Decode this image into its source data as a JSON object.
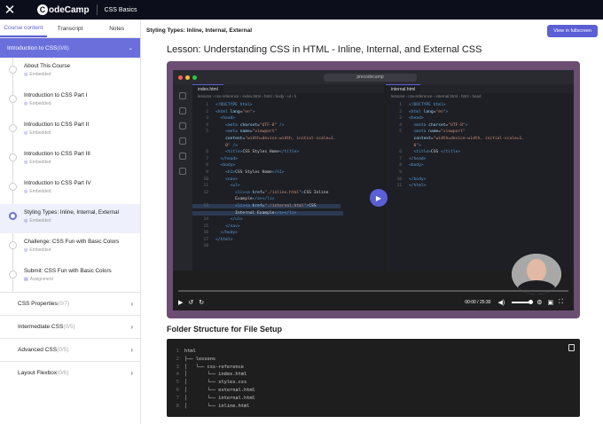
{
  "header": {
    "logo_text": "odeCamp",
    "logo_mark": "C",
    "course_title": "CSS Basics"
  },
  "sidebar": {
    "tabs": [
      "Course content",
      "Transcript",
      "Notes"
    ],
    "open_section": {
      "title": "Introduction to CSS",
      "count": "(0/8)"
    },
    "lessons": [
      {
        "title": "About This Course",
        "status": "Embedded"
      },
      {
        "title": "Introduction to CSS Part I",
        "status": "Embedded"
      },
      {
        "title": "Introduction to CSS Part II",
        "status": "Embedded"
      },
      {
        "title": "Introduction to CSS Part III",
        "status": "Embedded"
      },
      {
        "title": "Introduction to CSS Part IV",
        "status": "Embedded"
      },
      {
        "title": "Styling Types: Inline, Internal, External",
        "status": "Embedded"
      },
      {
        "title": "Challenge: CSS Fun with Basic Colors",
        "status": "Embedded"
      },
      {
        "title": "Submit: CSS Fun with Basic Colors",
        "status": "Assignment"
      }
    ],
    "sections": [
      {
        "title": "CSS Properties",
        "count": "(0/7)"
      },
      {
        "title": "Intermediate CSS",
        "count": "(0/5)"
      },
      {
        "title": "Advanced CSS",
        "count": "(0/5)"
      },
      {
        "title": "Layout Flexbox",
        "count": "(0/6)"
      }
    ]
  },
  "main": {
    "subheader_title": "Styling Types: Inline, Internal, External",
    "fullscreen_label": "View in fullscreen",
    "lesson_title": "Lesson: Understanding CSS in HTML - Inline, Internal, and External CSS",
    "video": {
      "search_text": "precodecamp",
      "left_tab": "index.html",
      "right_tab": "internal.html",
      "left_crumb": "lessons › css-reference › index.html › html › body › ul › li",
      "right_crumb": "lessons › css-reference › internal.html › html › head",
      "time": "00:00 / 25:30"
    },
    "tree_title": "Folder Structure for File Setup",
    "tree_lines": [
      "html",
      "├── lessons",
      "│   └── css-reference",
      "│       └── index.html",
      "│       └── styles.css",
      "│       └── external.html",
      "│       └── internal.html",
      "│       └── inline.html"
    ]
  }
}
